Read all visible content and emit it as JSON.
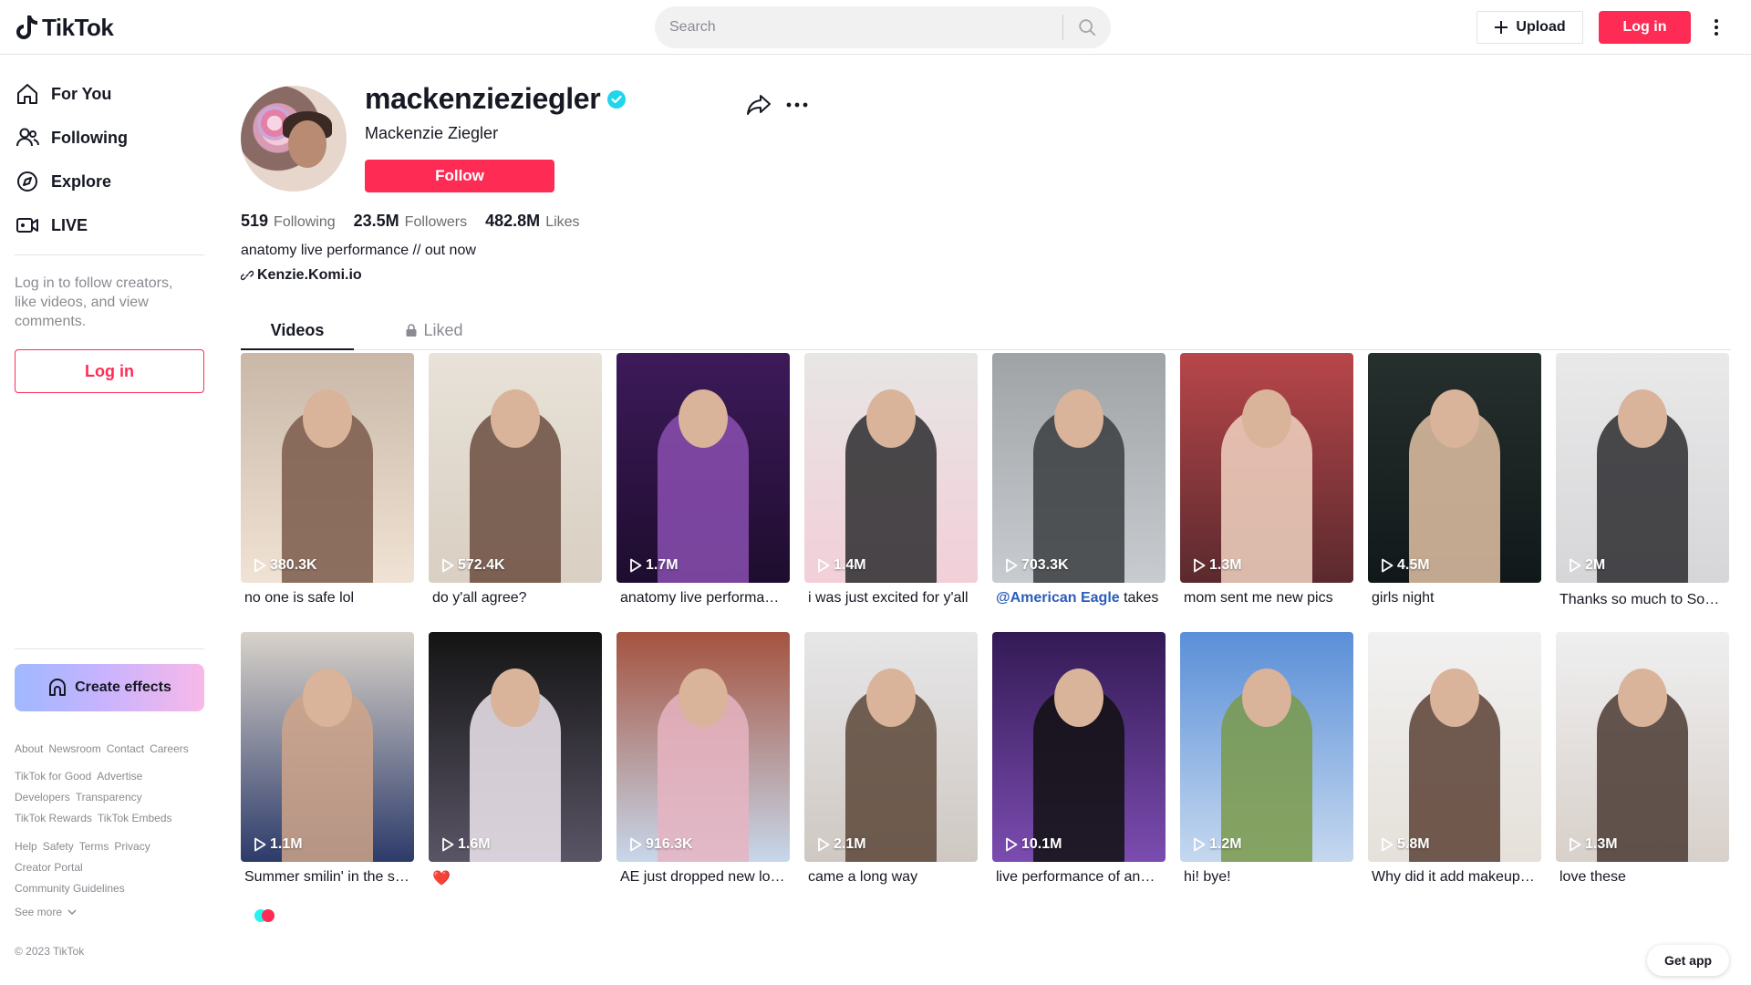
{
  "header": {
    "logo_text": "TikTok",
    "search_placeholder": "Search",
    "upload_label": "Upload",
    "login_label": "Log in"
  },
  "sidebar": {
    "nav": [
      {
        "label": "For You",
        "icon": "home-icon"
      },
      {
        "label": "Following",
        "icon": "users-icon"
      },
      {
        "label": "Explore",
        "icon": "compass-icon"
      },
      {
        "label": "LIVE",
        "icon": "live-icon"
      }
    ],
    "login_note": "Log in to follow creators, like videos, and view comments.",
    "login_button": "Log in",
    "create_effects": "Create effects",
    "footer_row1": [
      "About",
      "Newsroom",
      "Contact",
      "Careers"
    ],
    "footer_row2": [
      "TikTok for Good",
      "Advertise"
    ],
    "footer_row3": [
      "Developers",
      "Transparency"
    ],
    "footer_row4": [
      "TikTok Rewards",
      "TikTok Embeds"
    ],
    "footer_row5": [
      "Help",
      "Safety",
      "Terms",
      "Privacy"
    ],
    "footer_row6": [
      "Creator Portal"
    ],
    "footer_row7": [
      "Community Guidelines"
    ],
    "see_more": "See more",
    "copyright": "© 2023 TikTok"
  },
  "profile": {
    "username": "mackenzieziegler",
    "display_name": "Mackenzie Ziegler",
    "follow_label": "Follow",
    "following_count": "519",
    "following_label": "Following",
    "followers_count": "23.5M",
    "followers_label": "Followers",
    "likes_count": "482.8M",
    "likes_label": "Likes",
    "bio": "anatomy live performance // out now",
    "link": "Kenzie.Komi.io"
  },
  "tabs": {
    "videos": "Videos",
    "liked": "Liked"
  },
  "videos": [
    {
      "views": "380.3K",
      "caption": "no one is safe lol"
    },
    {
      "views": "572.4K",
      "caption": "do y'all agree?"
    },
    {
      "views": "1.7M",
      "caption": "anatomy live performance"
    },
    {
      "views": "1.4M",
      "caption": "i was just excited for y'all"
    },
    {
      "views": "703.3K",
      "caption_mention": "@American Eagle",
      "caption": " takes"
    },
    {
      "views": "1.3M",
      "caption": "mom sent me new pics"
    },
    {
      "views": "4.5M",
      "caption": "girls night"
    },
    {
      "views": "2M",
      "caption": "Thanks so much to SoFi ❤"
    },
    {
      "views": "1.1M",
      "caption": "Summer smilin' in the sun"
    },
    {
      "views": "1.6M",
      "caption": "❤️"
    },
    {
      "views": "916.3K",
      "caption": "AE just dropped new looks"
    },
    {
      "views": "2.1M",
      "caption": "came a long way"
    },
    {
      "views": "10.1M",
      "caption": "live performance of anatomy"
    },
    {
      "views": "1.2M",
      "caption": "hi! bye!"
    },
    {
      "views": "5.8M",
      "caption": "Why did it add makeup to me"
    },
    {
      "views": "1.3M",
      "caption": "love these"
    }
  ],
  "get_app": "Get app",
  "colors": {
    "brand": "#fe2c55",
    "verified": "#20d5ec"
  }
}
